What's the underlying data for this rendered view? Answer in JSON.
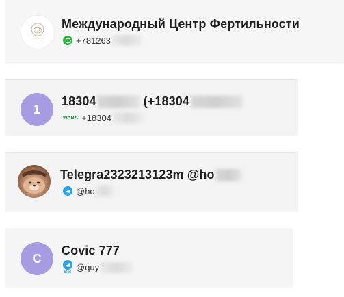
{
  "contacts": [
    {
      "name": "Международный Центр Фертильности",
      "channel_icon": "whatsapp-icon",
      "channel_color": "#2bb741",
      "handle": "+781263",
      "avatar_type": "logo"
    },
    {
      "avatar_text": "1",
      "name_prefix": "18304",
      "name_mid": " (+18304",
      "channel_icon": "waba-icon",
      "channel_label": "WABA",
      "handle": "+18304",
      "avatar_type": "letter",
      "avatar_color": "#a79be2"
    },
    {
      "name": "Telegra2323213123m @ho",
      "channel_icon": "telegram-icon",
      "channel_color": "#2aa3df",
      "handle": "@ho",
      "avatar_type": "photo"
    },
    {
      "avatar_text": "C",
      "name": "Covic 777",
      "channel_icon": "telegram-bot-icon",
      "channel_color": "#2aa3df",
      "channel_label": "Bot",
      "handle": "@quy",
      "avatar_type": "letter",
      "avatar_color": "#a79be2"
    }
  ]
}
